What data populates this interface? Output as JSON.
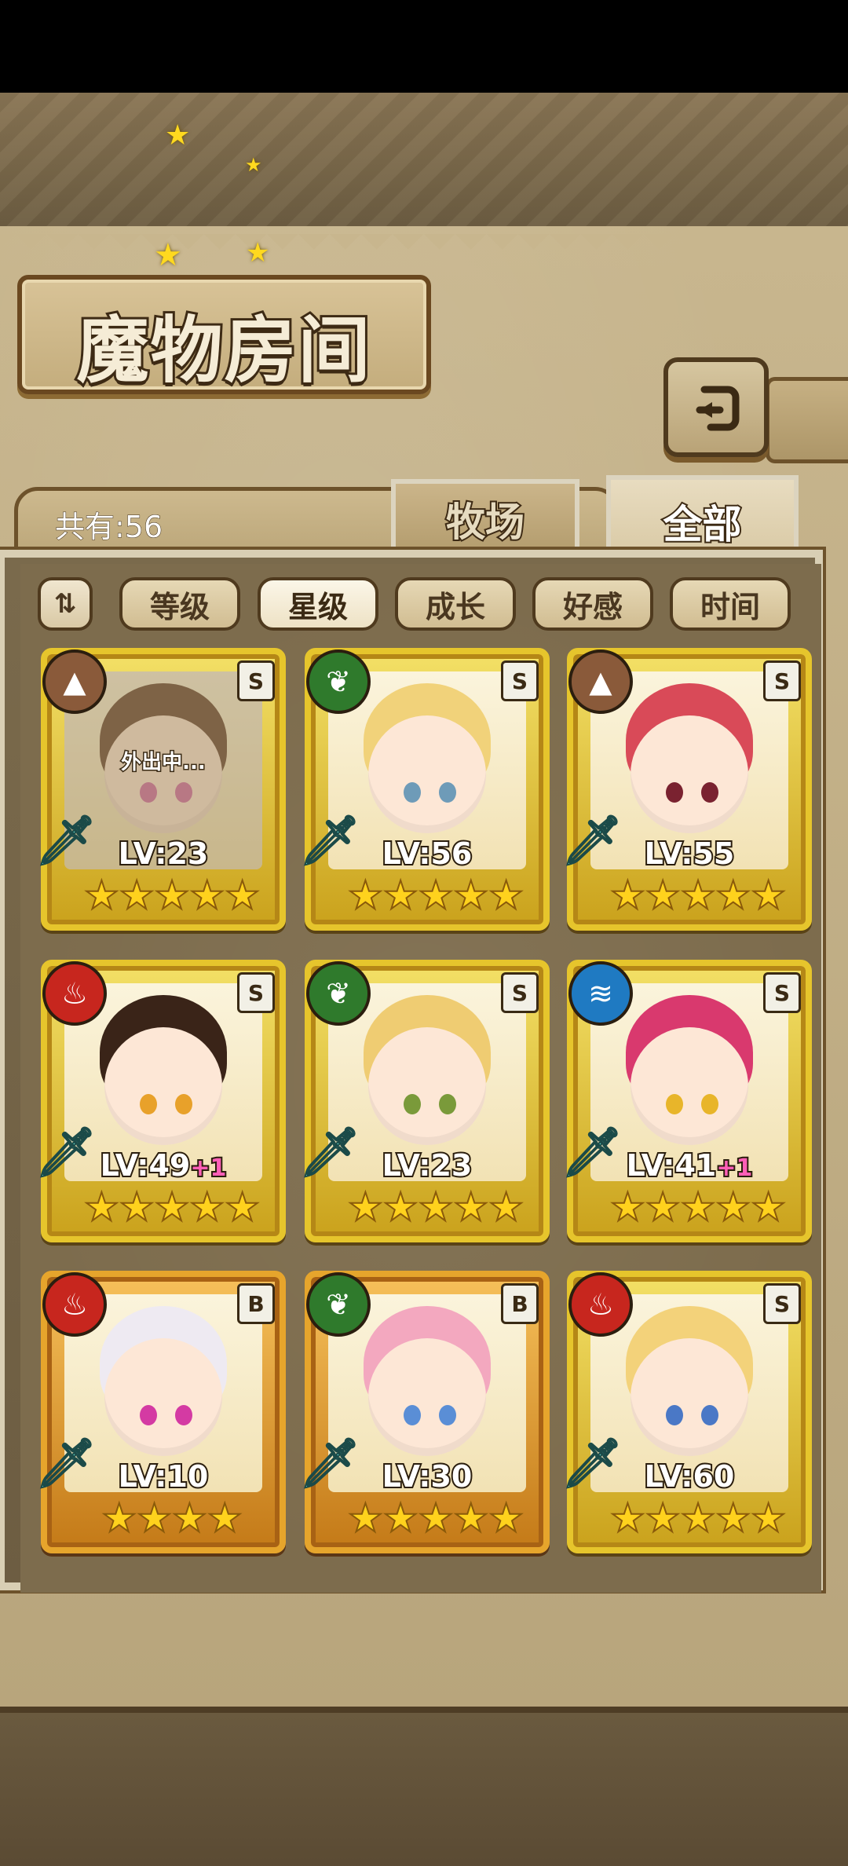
{
  "title": "魔物房间",
  "count_label": "共有:56",
  "tabs": [
    {
      "label": "牧场",
      "active": false
    },
    {
      "label": "全部",
      "active": true
    }
  ],
  "sort_buttons": [
    {
      "label": "等级",
      "active": false
    },
    {
      "label": "星级",
      "active": true
    },
    {
      "label": "成长",
      "active": false
    },
    {
      "label": "好感",
      "active": false
    },
    {
      "label": "时间",
      "active": false
    }
  ],
  "monsters": [
    {
      "element": "earth",
      "element_color": "#8a5a3a",
      "rank": "S",
      "level": "LV:23",
      "bonus": "",
      "stars": "★★★★★",
      "status": "外出中...",
      "hair": "#6b4a36",
      "eyes": "#d46fa6",
      "frame": "gold"
    },
    {
      "element": "leaf",
      "element_color": "#2f7a2c",
      "rank": "S",
      "level": "LV:56",
      "bonus": "",
      "stars": "★★★★★",
      "status": "",
      "hair": "#f1d27a",
      "eyes": "#6e9bb8",
      "frame": "gold"
    },
    {
      "element": "earth",
      "element_color": "#8a5a3a",
      "rank": "S",
      "level": "LV:55",
      "bonus": "",
      "stars": "★★★★★",
      "status": "",
      "hair": "#d94a58",
      "eyes": "#7a2230",
      "frame": "gold"
    },
    {
      "element": "fire",
      "element_color": "#c7261e",
      "rank": "S",
      "level": "LV:49",
      "bonus": "+1",
      "stars": "★★★★★",
      "status": "",
      "hair": "#3a2418",
      "eyes": "#e8a12a",
      "frame": "gold"
    },
    {
      "element": "leaf",
      "element_color": "#2f7a2c",
      "rank": "S",
      "level": "LV:23",
      "bonus": "",
      "stars": "★★★★★",
      "status": "",
      "hair": "#efcc72",
      "eyes": "#7a9a3a",
      "frame": "gold"
    },
    {
      "element": "water",
      "element_color": "#1f7ac2",
      "rank": "S",
      "level": "LV:41",
      "bonus": "+1",
      "stars": "★★★★★",
      "status": "",
      "hair": "#d9396e",
      "eyes": "#e8b52a",
      "frame": "gold"
    },
    {
      "element": "fire",
      "element_color": "#c7261e",
      "rank": "B",
      "level": "LV:10",
      "bonus": "",
      "stars": "★★★★",
      "status": "",
      "hair": "#eeeaf2",
      "eyes": "#d43aa3",
      "frame": "bronze"
    },
    {
      "element": "leaf",
      "element_color": "#2f7a2c",
      "rank": "B",
      "level": "LV:30",
      "bonus": "",
      "stars": "★★★★★",
      "status": "",
      "hair": "#f3a8bf",
      "eyes": "#5a8ed6",
      "frame": "bronze"
    },
    {
      "element": "fire",
      "element_color": "#c7261e",
      "rank": "S",
      "level": "LV:60",
      "bonus": "",
      "stars": "★★★★★",
      "status": "",
      "hair": "#f3d27a",
      "eyes": "#4a78c6",
      "frame": "gold"
    }
  ]
}
